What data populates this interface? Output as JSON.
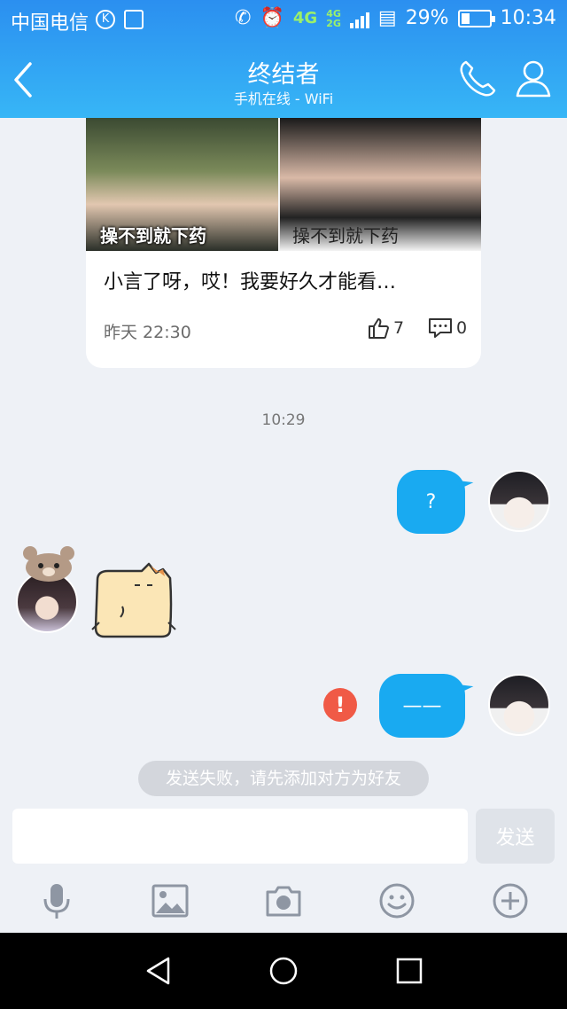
{
  "status_bar": {
    "carrier": "中国电信",
    "network": "4G",
    "network_small_top": "4G",
    "network_small_bottom": "2G",
    "battery_percent": "29%",
    "battery_level": 0.29,
    "time": "10:34"
  },
  "header": {
    "title": "终结者",
    "subtitle": "手机在线 - WiFi"
  },
  "share_card": {
    "image1_caption": "操不到就下药",
    "image2_caption": "操不到就下药",
    "text": "小言了呀，哎！我要好久才能看…",
    "time": "昨天 22:30",
    "likes": "7",
    "comments": "0"
  },
  "messages": {
    "timestamp": "10:29",
    "bubble1": "?",
    "bubble2": "——",
    "error_icon": "!"
  },
  "notice": "发送失败，请先添加对方为好友",
  "composer": {
    "placeholder": "",
    "send_label": "发送"
  },
  "toolbar": [
    "microphone-icon",
    "image-icon",
    "camera-icon",
    "emoji-icon",
    "plus-icon"
  ],
  "colors": {
    "header_top": "#2b8ff0",
    "header_bottom": "#37b6f6",
    "bubble": "#19aaf1",
    "error": "#f05a46",
    "background": "#eef1f6"
  }
}
